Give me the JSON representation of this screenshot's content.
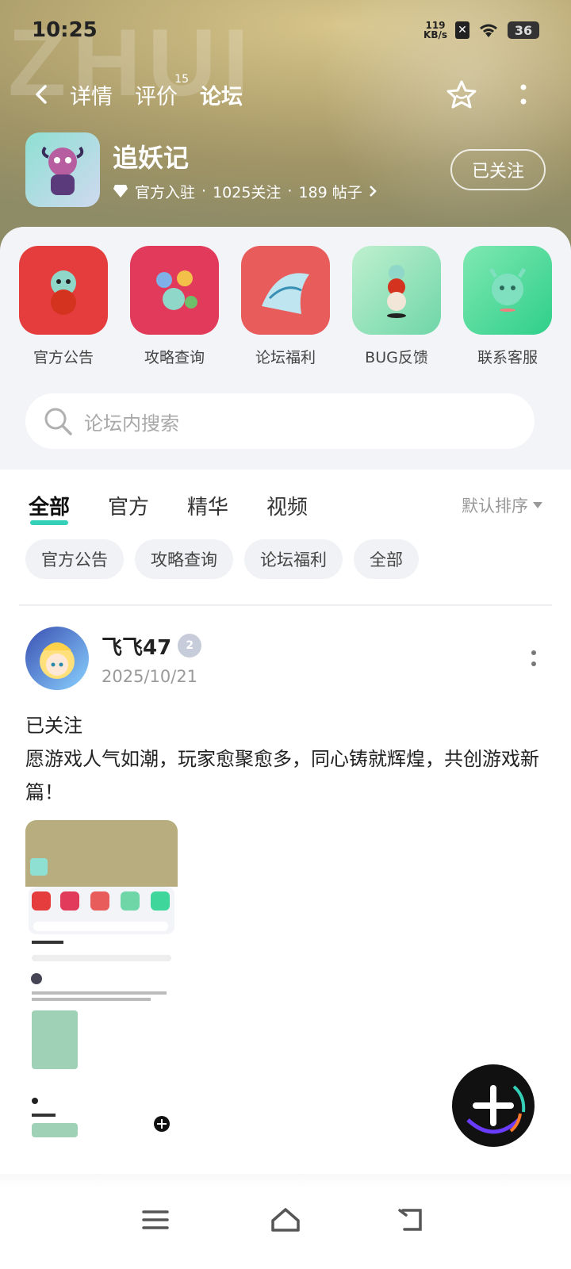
{
  "status_bar": {
    "time": "10:25",
    "net_speed": "119",
    "net_unit": "KB/s",
    "battery": "36"
  },
  "header": {
    "back_icon": "chevron-left-icon",
    "tabs": [
      {
        "label": "详情"
      },
      {
        "label": "评价",
        "badge": "15"
      },
      {
        "label": "论坛"
      }
    ],
    "active_tab": "论坛",
    "accent": "#35d0b8"
  },
  "game": {
    "name": "追妖记",
    "official": "官方入驻",
    "followers": "1025关注",
    "posts": "189 帖子",
    "sep": "·",
    "follow_label": "已关注"
  },
  "shortcuts": [
    {
      "label": "官方公告",
      "color": "#e53d3d"
    },
    {
      "label": "攻略查询",
      "color": "#e23a5a"
    },
    {
      "label": "论坛福利",
      "color": "#e85c5c"
    },
    {
      "label": "BUG反馈",
      "color": "#6fd6a8"
    },
    {
      "label": "联系客服",
      "color": "#3fd69c"
    }
  ],
  "search": {
    "placeholder": "论坛内搜索"
  },
  "filters": {
    "tabs": [
      "全部",
      "官方",
      "精华",
      "视频"
    ],
    "active": "全部",
    "sort_label": "默认排序"
  },
  "chips": [
    "官方公告",
    "攻略查询",
    "论坛福利",
    "全部"
  ],
  "post": {
    "user": "飞飞47",
    "level": "2",
    "date": "2025/10/21",
    "line1": "已关注",
    "line2": "愿游戏人气如潮，玩家愈聚愈多，同心铸就辉煌，共创游戏新篇！"
  },
  "fab": {
    "icon": "plus-icon"
  },
  "system_nav": {
    "icons": [
      "menu-icon",
      "home-icon",
      "back-icon"
    ]
  }
}
